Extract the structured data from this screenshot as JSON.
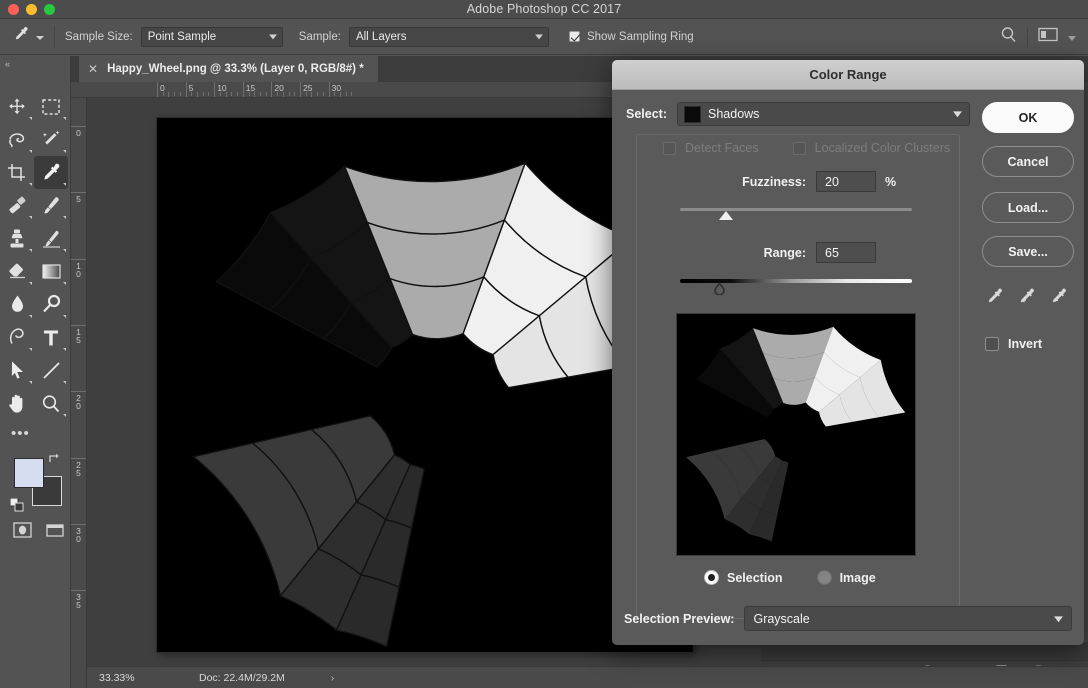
{
  "window": {
    "title": "Adobe Photoshop CC 2017"
  },
  "options_bar": {
    "tool_icon": "eyedropper-icon",
    "sample_size_label": "Sample Size:",
    "sample_size_value": "Point Sample",
    "sample_label": "Sample:",
    "sample_value": "All Layers",
    "show_sampling_ring_label": "Show Sampling Ring",
    "show_sampling_ring_checked": true,
    "search_icon": "search-icon",
    "arrange_icon": "workspace-arrange-icon"
  },
  "toolbar": {
    "collapse_label": "«",
    "tools": [
      {
        "name": "move-tool",
        "icon": "move-icon"
      },
      {
        "name": "rectangular-marquee-tool",
        "icon": "marquee-icon"
      },
      {
        "name": "lasso-tool",
        "icon": "lasso-icon"
      },
      {
        "name": "quick-selection-tool",
        "icon": "magic-wand-icon"
      },
      {
        "name": "crop-tool",
        "icon": "crop-icon"
      },
      {
        "name": "eyedropper-tool",
        "icon": "eyedropper-icon"
      },
      {
        "name": "spot-healing-tool",
        "icon": "healing-brush-icon"
      },
      {
        "name": "brush-tool",
        "icon": "brush-icon"
      },
      {
        "name": "clone-stamp-tool",
        "icon": "stamp-icon"
      },
      {
        "name": "history-brush-tool",
        "icon": "history-brush-icon"
      },
      {
        "name": "eraser-tool",
        "icon": "eraser-icon"
      },
      {
        "name": "gradient-tool",
        "icon": "gradient-icon"
      },
      {
        "name": "blur-tool",
        "icon": "blur-drop-icon"
      },
      {
        "name": "dodge-tool",
        "icon": "dodge-icon"
      },
      {
        "name": "pen-tool",
        "icon": "pen-icon"
      },
      {
        "name": "type-tool",
        "icon": "type-t-icon"
      },
      {
        "name": "path-selection-tool",
        "icon": "arrow-pointer-icon"
      },
      {
        "name": "line-tool",
        "icon": "line-icon"
      },
      {
        "name": "hand-tool",
        "icon": "hand-icon"
      },
      {
        "name": "zoom-tool",
        "icon": "magnifier-icon"
      }
    ],
    "more_tools": "•••",
    "active_tool": "eyedropper-tool",
    "foreground_color": "#d6ddf0",
    "background_color": "#3a3a3a"
  },
  "document": {
    "tab_label": "Happy_Wheel.png @ 33.3% (Layer 0, RGB/8#) *",
    "close_icon": "close-icon",
    "h_ruler_ticks": [
      "0",
      "5",
      "10",
      "15",
      "20",
      "25",
      "30"
    ],
    "v_ruler_ticks": [
      "0",
      "5",
      "10",
      "15",
      "20",
      "25",
      "30",
      "35"
    ]
  },
  "status_bar": {
    "zoom": "33.33%",
    "doc": "Doc: 22.4M/29.2M",
    "arrow": "›"
  },
  "layers_panel_footer": {
    "icons": [
      "link-icon",
      "fx-icon",
      "layer-mask-icon",
      "adjustment-layer-icon",
      "new-group-icon",
      "new-layer-icon",
      "delete-layer-icon"
    ]
  },
  "dialog": {
    "title": "Color Range",
    "select_label": "Select:",
    "select_value": "Shadows",
    "select_swatch_color": "#0a0a0a",
    "detect_faces_label": "Detect Faces",
    "detect_faces_checked": false,
    "detect_faces_enabled": false,
    "localized_clusters_label": "Localized Color Clusters",
    "localized_clusters_checked": false,
    "localized_clusters_enabled": false,
    "fuzziness_label": "Fuzziness:",
    "fuzziness_value": "20",
    "fuzziness_unit": "%",
    "fuzziness_percent": 20,
    "range_label": "Range:",
    "range_value": "65",
    "range_percent": 17,
    "preview_mode_selection": "Selection",
    "preview_mode_image": "Image",
    "preview_mode_active": "Selection",
    "selection_preview_label": "Selection Preview:",
    "selection_preview_value": "Grayscale",
    "buttons": {
      "ok": "OK",
      "cancel": "Cancel",
      "load": "Load...",
      "save": "Save..."
    },
    "eyedroppers": [
      "eyedropper-icon",
      "eyedropper-add-icon",
      "eyedropper-subtract-icon"
    ],
    "invert_label": "Invert",
    "invert_checked": false
  },
  "artwork": {
    "name": "happy-wheel",
    "background": "#000000",
    "sectors": [
      {
        "start_deg": 193,
        "end_deg": 231,
        "fill": "#3a3a3a"
      },
      {
        "start_deg": 231,
        "end_deg": 246,
        "fill": "#2e2e2e"
      },
      {
        "start_deg": 246,
        "end_deg": 258,
        "fill": "#2a2a2a"
      },
      {
        "start_deg": 132,
        "end_deg": 152,
        "fill": "#0a0a0a"
      },
      {
        "start_deg": 112,
        "end_deg": 132,
        "fill": "#141414"
      },
      {
        "start_deg": 70,
        "end_deg": 112,
        "fill": "#ababab"
      },
      {
        "start_deg": 40,
        "end_deg": 70,
        "fill": "#f0f0f0"
      },
      {
        "start_deg": 10,
        "end_deg": 40,
        "fill": "#e4e4e4"
      }
    ]
  }
}
